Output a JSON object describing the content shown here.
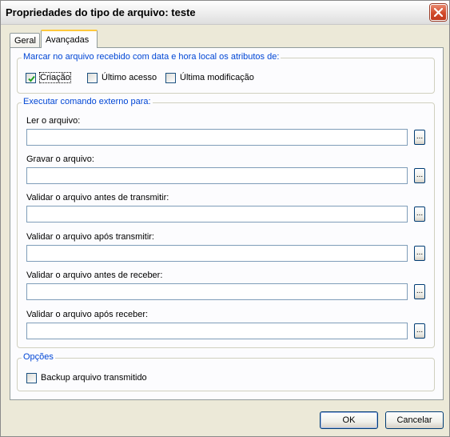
{
  "window": {
    "title": "Propriedades do tipo de arquivo: teste"
  },
  "tabs": [
    {
      "label": "Geral",
      "active": false
    },
    {
      "label": "Avançadas",
      "active": true
    }
  ],
  "timestamp_group": {
    "title": "Marcar no arquivo recebido com data e hora local os atributos de:",
    "options": [
      {
        "label": "Criação",
        "checked": true
      },
      {
        "label": "Último acesso",
        "checked": false
      },
      {
        "label": "Última modificação",
        "checked": false
      }
    ]
  },
  "command_group": {
    "title": "Executar comando externo para:",
    "browse_label": "...",
    "fields": [
      {
        "label": "Ler o arquivo:",
        "value": ""
      },
      {
        "label": "Gravar o arquivo:",
        "value": ""
      },
      {
        "label": "Validar o arquivo antes de transmitir:",
        "value": ""
      },
      {
        "label": "Validar o arquivo após transmitir:",
        "value": ""
      },
      {
        "label": "Validar o arquivo antes de receber:",
        "value": ""
      },
      {
        "label": "Validar o arquivo após receber:",
        "value": ""
      }
    ]
  },
  "options_group": {
    "title": "Opções",
    "backup": {
      "label": "Backup arquivo transmitido",
      "checked": false
    }
  },
  "buttons": {
    "ok": "OK",
    "cancel": "Cancelar"
  }
}
